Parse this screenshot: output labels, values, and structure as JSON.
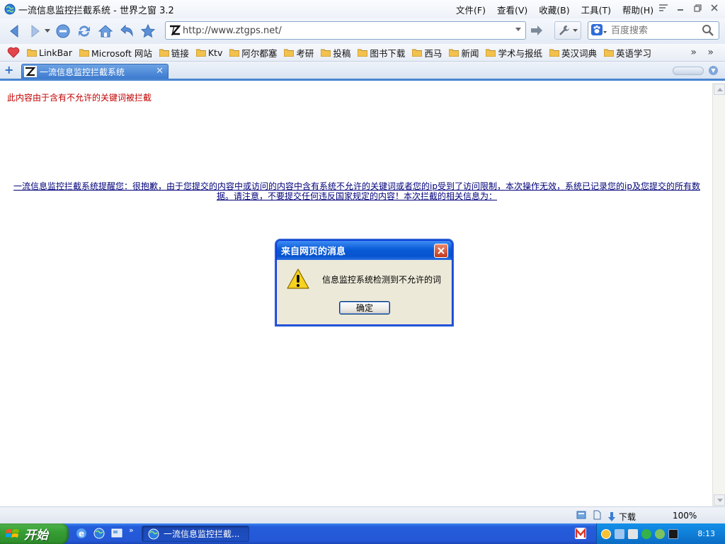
{
  "window": {
    "title": "一流信息监控拦截系统 - 世界之窗 3.2",
    "menu": [
      "文件(F)",
      "查看(V)",
      "收藏(B)",
      "工具(T)",
      "帮助(H)"
    ]
  },
  "address_bar": {
    "url": "http://www.ztgps.net/"
  },
  "search": {
    "placeholder": "百度搜索"
  },
  "bookmarks": [
    "LinkBar",
    "Microsoft 网站",
    "链接",
    "Ktv",
    "阿尔都塞",
    "考研",
    "投稿",
    "图书下载",
    "西马",
    "新闻",
    "学术与报纸",
    "英汉词典",
    "英语学习"
  ],
  "tab": {
    "title": "一流信息监控拦截系统"
  },
  "page": {
    "blocked_message": "此内容由于含有不允许的关键词被拦截",
    "notice_line1": "一流信息监控拦截系统提醒您：很抱歉，由于您提交的内容中或访问的内容中含有系统不允许的关键词或者您的ip受到了访问限制，本次操作无效，系统已记录您的ip及您提交的所有数",
    "notice_line2": "据。请注意，不要提交任何违反国家规定的内容！本次拦截的相关信息为："
  },
  "dialog": {
    "title": "来自网页的消息",
    "message": "信息监控系统检测到不允许的词",
    "ok_label": "确定"
  },
  "statusbar": {
    "download_label": "下载",
    "zoom": "100%"
  },
  "taskbar": {
    "start_label": "开始",
    "task_label": "一流信息监控拦截...",
    "clock": "8:13"
  },
  "colors": {
    "blocked_text": "#c00000",
    "notice_link": "#00007a",
    "tab_active": "#3c7ad0",
    "dialog_title": "#0a5bd6",
    "taskbar": "#245ddb",
    "start_button": "#379e35"
  }
}
